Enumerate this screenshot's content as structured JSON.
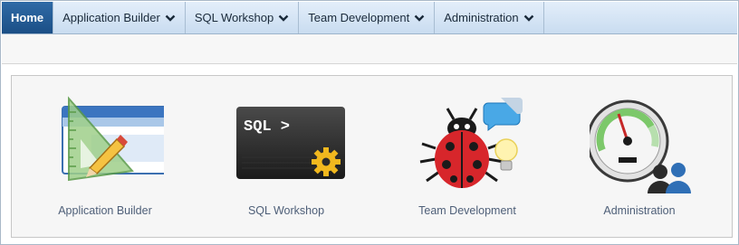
{
  "nav": {
    "tabs": [
      {
        "label": "Home",
        "active": true
      },
      {
        "label": "Application Builder",
        "active": false
      },
      {
        "label": "SQL Workshop",
        "active": false
      },
      {
        "label": "Team Development",
        "active": false
      },
      {
        "label": "Administration",
        "active": false
      }
    ]
  },
  "tiles": [
    {
      "label": "Application Builder",
      "icon": "application-builder-icon"
    },
    {
      "label": "SQL Workshop",
      "icon": "sql-workshop-icon",
      "icon_text": "SQL >"
    },
    {
      "label": "Team Development",
      "icon": "team-development-icon"
    },
    {
      "label": "Administration",
      "icon": "administration-icon"
    }
  ],
  "colors": {
    "active_tab": "#1b4f86",
    "nav_bg": "#d4e4f5",
    "tile_label": "#4e5f78"
  }
}
